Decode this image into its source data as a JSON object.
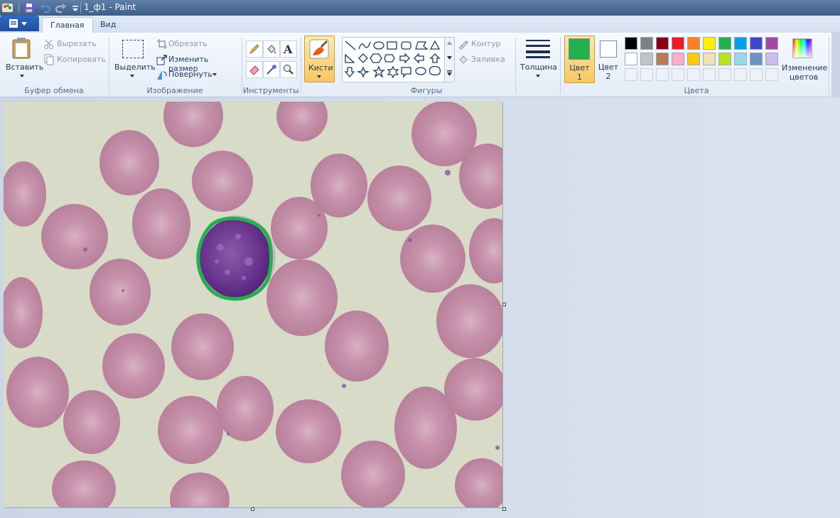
{
  "window": {
    "title": "1_ф1 - Paint"
  },
  "tabs": [
    "Главная",
    "Вид"
  ],
  "clipboard": {
    "paste": "Вставить",
    "cut": "Вырезать",
    "copy": "Копировать",
    "group": "Буфер обмена"
  },
  "image": {
    "select": "Выделить",
    "crop": "Обрезать",
    "resize": "Изменить размер",
    "rotate": "Повернуть",
    "group": "Изображение"
  },
  "tools": {
    "group": "Инструменты",
    "icons": [
      "pencil-icon",
      "fill-icon",
      "text-icon",
      "eraser-icon",
      "color-picker-icon",
      "magnifier-icon"
    ]
  },
  "brushes": {
    "label": "Кисти"
  },
  "shapes": {
    "group": "Фигуры",
    "outline": "Контур",
    "fill": "Заливка"
  },
  "size": {
    "label": "Толщина"
  },
  "colors": {
    "color1": "Цвет 1",
    "color2": "Цвет 2",
    "edit": "Изменение цветов",
    "group": "Цвета",
    "color1_value": "#22b14c",
    "color2_value": "#ffffff",
    "row1": [
      "#000000",
      "#7f7f7f",
      "#880015",
      "#ed1c24",
      "#ff7f27",
      "#fff200",
      "#22b14c",
      "#00a2e8",
      "#3f48cc",
      "#a349a4"
    ],
    "row2": [
      "#ffffff",
      "#c3c3c3",
      "#b97a57",
      "#ffaec9",
      "#ffc90e",
      "#efe4b0",
      "#b5e61d",
      "#99d9ea",
      "#7092be",
      "#c8bfe7"
    ]
  },
  "canvas": {
    "content": "microscope-blood-smear-image",
    "outline_color": "#22b14c"
  }
}
